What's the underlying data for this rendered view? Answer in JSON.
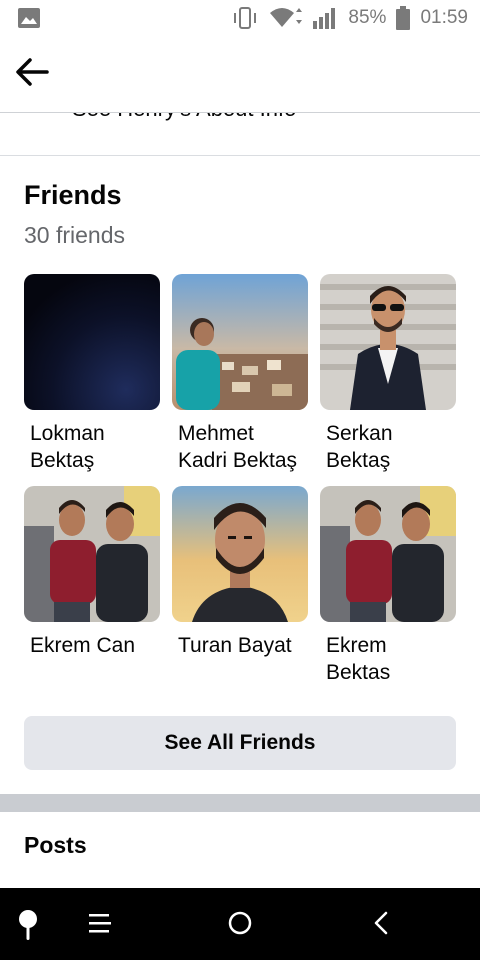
{
  "status_bar": {
    "battery": "85%",
    "time": "01:59",
    "icons": [
      "gallery-icon",
      "vibrate-icon",
      "wifi-icon",
      "signal-icon",
      "battery-icon"
    ]
  },
  "app_bar": {
    "back_icon": "arrow-left-icon"
  },
  "about_link": "See Henry's About Info",
  "friends": {
    "title": "Friends",
    "count": "30 friends",
    "items": [
      {
        "name": "Lokman Bektaş"
      },
      {
        "name": "Mehmet Kadri Bektaş"
      },
      {
        "name": "Serkan Bektaş"
      },
      {
        "name": "Ekrem Can"
      },
      {
        "name": "Turan Bayat"
      },
      {
        "name": "Ekrem Bektas"
      }
    ],
    "see_all_label": "See All Friends"
  },
  "posts": {
    "title": "Posts"
  },
  "nav_bar": {
    "icons": [
      "pin-icon",
      "menu-icon",
      "home-circle-icon",
      "back-chevron-icon"
    ]
  },
  "colors": {
    "background": "#ffffff",
    "secondary_text": "#65676b",
    "button_bg": "#e4e6eb",
    "section_divider": "#c9ccd1",
    "nav_bar": "#000000"
  }
}
